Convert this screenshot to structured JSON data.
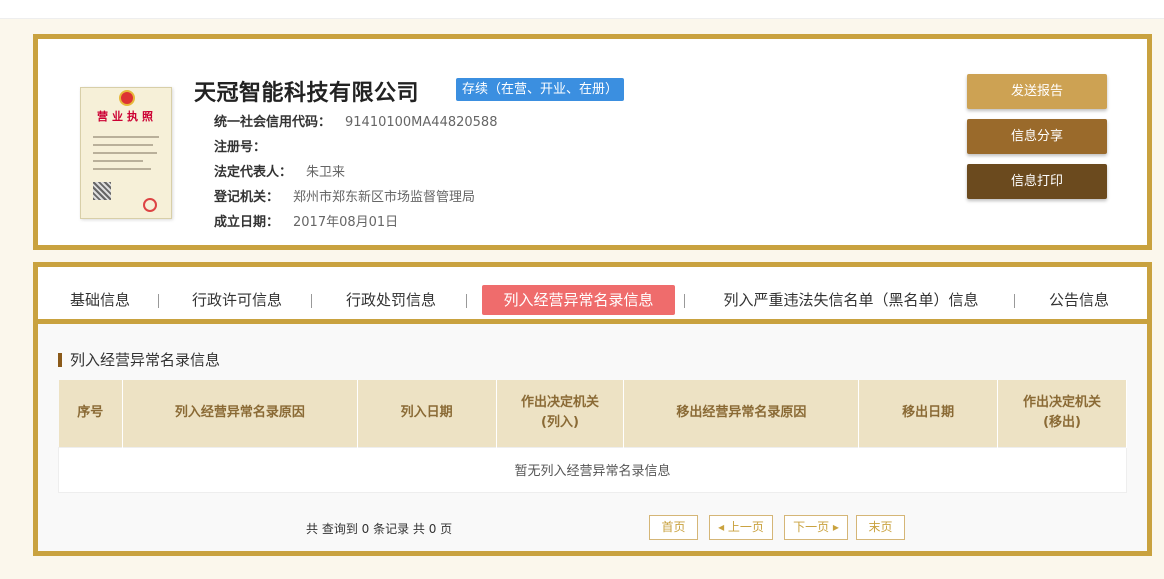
{
  "company": {
    "name": "天冠智能科技有限公司",
    "status": "存续（在营、开业、在册）",
    "fields": [
      {
        "label": "统一社会信用代码：",
        "value": "91410100MA44820588"
      },
      {
        "label": "注册号：",
        "value": ""
      },
      {
        "label": "法定代表人：",
        "value": "朱卫来"
      },
      {
        "label": "登记机关：",
        "value": "郑州市郑东新区市场监督管理局"
      },
      {
        "label": "成立日期：",
        "value": "2017年08月01日"
      }
    ],
    "license_title": "营业执照"
  },
  "actions": {
    "report": "发送报告",
    "share": "信息分享",
    "print": "信息打印"
  },
  "tabs": [
    "基础信息",
    "行政许可信息",
    "行政处罚信息",
    "列入经营异常名录信息",
    "列入严重违法失信名单（黑名单）信息",
    "公告信息"
  ],
  "active_tab": "列入经营异常名录信息",
  "section": {
    "title": "列入经营异常名录信息",
    "columns": [
      "序号",
      "列入经营异常名录原因",
      "列入日期",
      "作出决定机关\n(列入)",
      "移出经营异常名录原因",
      "移出日期",
      "作出决定机关\n(移出)"
    ],
    "empty_text": "暂无列入经营异常名录信息"
  },
  "pagination": {
    "summary": "共 查询到 0 条记录 共 0 页",
    "first": "首页",
    "prev": "上一页",
    "next": "下一页",
    "last": "末页"
  },
  "colors": {
    "frame": "#c9a23f",
    "badge": "#3b8fe0",
    "active_tab": "#ef6c6c"
  }
}
